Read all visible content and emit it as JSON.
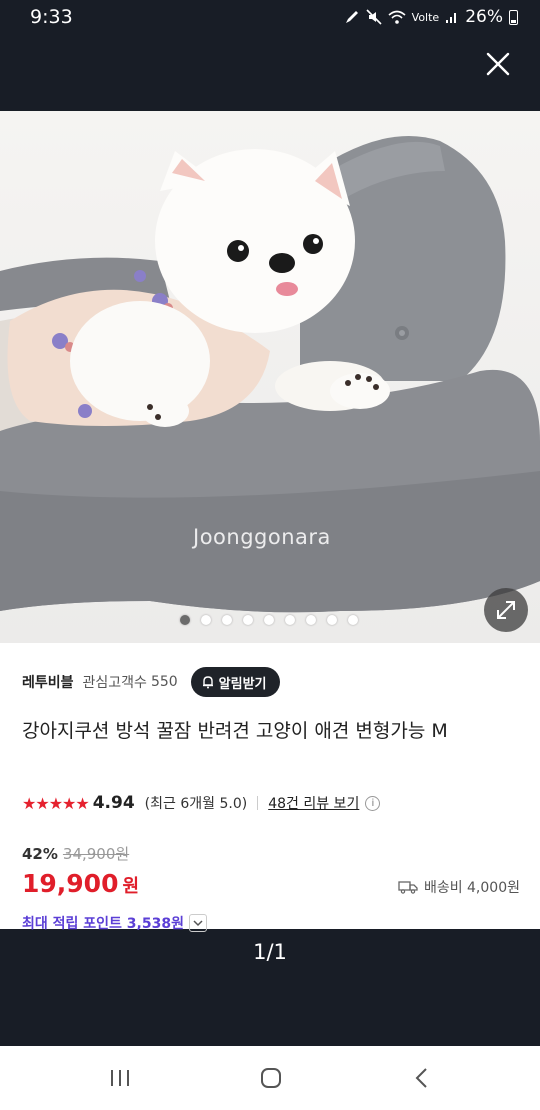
{
  "status_bar": {
    "time": "9:33",
    "network": "Volte",
    "battery": "26%"
  },
  "viewer": {
    "watermark": "Joonggonara",
    "dots_total": 9,
    "active_dot": 0,
    "page_counter": "1/1"
  },
  "product": {
    "seller_name": "레투비블",
    "follower_label": "관심고객수",
    "follower_count": "550",
    "alarm_label": "알림받기",
    "title": "강아지쿠션 방석 꿀잠 반려견 고양이 애견 변형가능 M",
    "stars": "★★★★★",
    "rating": "4.94",
    "recent_rating": "(최근 6개월 5.0)",
    "review_link": "48건 리뷰 보기",
    "discount": "42%",
    "original_price": "34,900원",
    "price": "19,900",
    "price_unit": "원",
    "shipping": "배송비 4,000원",
    "points": "최대 적립 포인트 3,538원"
  },
  "colors": {
    "price_red": "#e01e2a",
    "star_red": "#e5212e",
    "points_purple": "#5b3fd6",
    "dark_bg": "#181d26"
  }
}
